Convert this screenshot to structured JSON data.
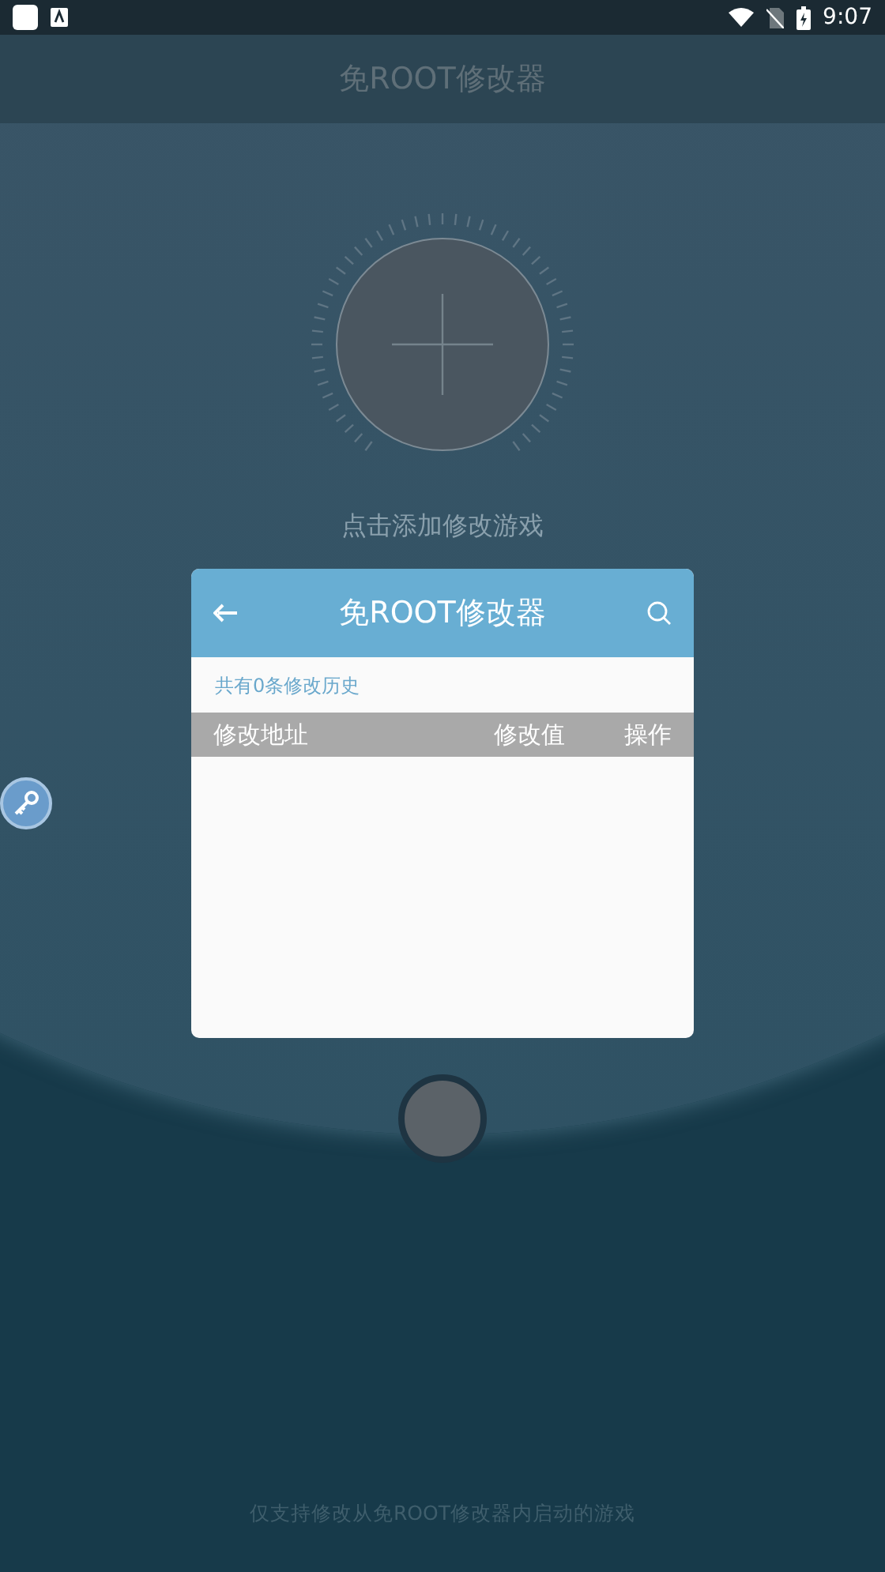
{
  "status_bar": {
    "time": "9:07"
  },
  "app_bar": {
    "title": "免ROOT修改器"
  },
  "add_prompt": "点击添加修改游戏",
  "dialog": {
    "title": "免ROOT修改器",
    "history_count": "共有0条修改历史",
    "columns": [
      {
        "label": "修改地址"
      },
      {
        "label": "修改值"
      },
      {
        "label": "操作"
      }
    ]
  },
  "footer": "仅支持修改从免ROOT修改器内启动的游戏"
}
